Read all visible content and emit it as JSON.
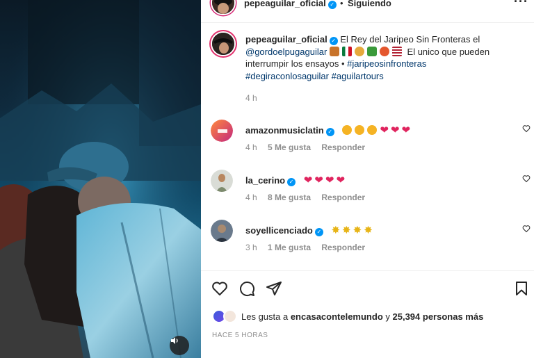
{
  "header": {
    "username": "pepeaguilar_oficial",
    "separator": "•",
    "follow_label": "Siguiendo",
    "more_icon": "more-horizontal-icon"
  },
  "caption": {
    "username": "pepeaguilar_oficial",
    "text_1": " El Rey del Jaripeo Sin Fronteras el",
    "mention": "@gordoelpugaguilar",
    "text_2": " El unico que pueden interrumpir los ensayos • ",
    "hashtags": [
      "#jaripeosinfronteras",
      "#degiraconlosaguilar",
      "#aguilartours"
    ],
    "time": "4 h"
  },
  "comments": [
    {
      "username": "amazonmusiclatin",
      "text": "",
      "emoji_names": [
        "star-struck",
        "star-struck",
        "star-struck",
        "red-heart",
        "red-heart",
        "red-heart"
      ],
      "time": "4 h",
      "likes": "5 Me gusta",
      "reply": "Responder"
    },
    {
      "username": "la_cerino",
      "text": "",
      "emoji_names": [
        "red-heart",
        "red-heart",
        "red-heart",
        "red-heart"
      ],
      "time": "4 h",
      "likes": "8 Me gusta",
      "reply": "Responder"
    },
    {
      "username": "soyellicenciado",
      "text": "",
      "emoji_names": [
        "sparkles-burst",
        "sparkles-burst",
        "sparkles-burst",
        "sparkles-burst"
      ],
      "time": "3 h",
      "likes": "1 Me gusta",
      "reply": "Responder"
    }
  ],
  "likes": {
    "prefix": "Les gusta a ",
    "user": "encasacontelemundo",
    "joiner": " y ",
    "count": "25,394 personas más"
  },
  "post_time": "HACE 5 HORAS",
  "colors": {
    "link": "#00376b",
    "verified": "#0095f6",
    "muted": "#8e8e8e",
    "heart": "#e0245e"
  }
}
